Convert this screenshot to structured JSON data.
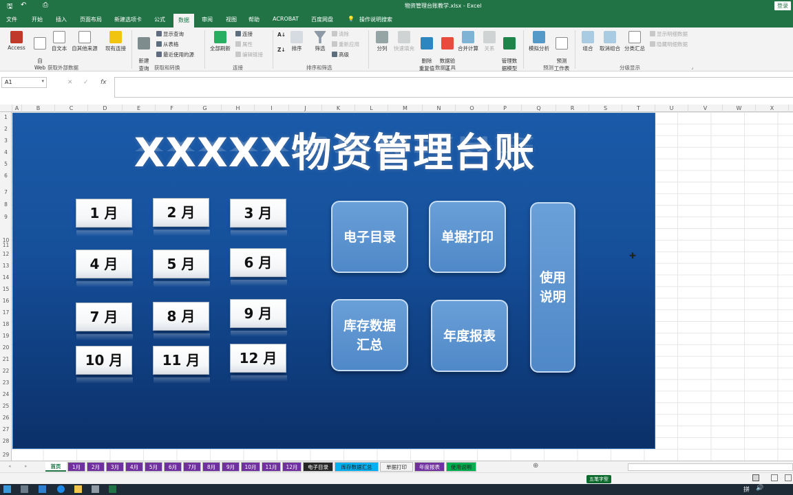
{
  "window": {
    "title": "物资管理台账教学.xlsx  -  Excel",
    "login_label": "登录"
  },
  "ribbon_tabs": [
    "文件",
    "开始",
    "插入",
    "页面布局",
    "新建选项卡",
    "公式",
    "数据",
    "审阅",
    "视图",
    "帮助",
    "ACROBAT",
    "百度网盘",
    "操作说明搜索"
  ],
  "ribbon_active_tab": "数据",
  "ribbon": {
    "get_external": {
      "access": "Access",
      "web": "自\nWeb",
      "text": "自文本",
      "other": "自其他来源",
      "existing": "现有连接",
      "group": "获取外部数据"
    },
    "transform": {
      "new_query": "新建\n查询",
      "show_queries": "显示查询",
      "from_table": "从表格",
      "recent_sources": "最近使用的源",
      "group": "获取和转换"
    },
    "connections": {
      "refresh_all": "全部刷新",
      "connections": "连接",
      "properties": "属性",
      "edit_links": "编辑链接",
      "group": "连接"
    },
    "sort_filter": {
      "sort": "排序",
      "filter": "筛选",
      "clear": "清除",
      "reapply": "重新应用",
      "advanced": "高级",
      "group": "排序和筛选"
    },
    "data_tools": {
      "split": "分列",
      "flash_fill": "快速填充",
      "remove_dup": "删除\n重复值",
      "validation": "数据验\n证",
      "consolidate": "合并计算",
      "relationships": "关系",
      "data_model": "管理数\n据模型",
      "group": "数据工具"
    },
    "forecast": {
      "what_if": "模拟分析",
      "forecast_sheet": "预测\n工作表",
      "group": "预测"
    },
    "outline": {
      "group_btn": "组合",
      "ungroup": "取消组合",
      "subtotal": "分类汇总",
      "show_detail": "显示明细数据",
      "hide_detail": "隐藏明细数据",
      "group": "分级显示"
    }
  },
  "formula_bar": {
    "name_box": "A1",
    "fx": "fx",
    "value": ""
  },
  "columns": [
    "A",
    "B",
    "C",
    "D",
    "E",
    "F",
    "G",
    "H",
    "I",
    "J",
    "K",
    "L",
    "M",
    "N",
    "O",
    "P",
    "Q",
    "R",
    "S",
    "T",
    "U",
    "V",
    "W",
    "X"
  ],
  "rows": [
    "1",
    "2",
    "3",
    "4",
    "5",
    "6",
    "7",
    "8",
    "9",
    "10",
    "11",
    "12",
    "13",
    "14",
    "15",
    "16",
    "17",
    "18",
    "19",
    "20",
    "21",
    "22",
    "23",
    "24",
    "25",
    "26",
    "27",
    "28",
    "29"
  ],
  "dashboard": {
    "title": "XXXXX物资管理台账",
    "months": [
      "1 月",
      "2 月",
      "3 月",
      "4 月",
      "5 月",
      "6 月",
      "7 月",
      "8 月",
      "9 月",
      "10 月",
      "11 月",
      "12 月"
    ],
    "nav": {
      "catalog": "电子目录",
      "print": "单据打印",
      "summary": "库存数据\n汇总",
      "annual": "年度报表",
      "manual": "使用\n说明"
    }
  },
  "sheet_tabs": [
    {
      "label": "首页",
      "color": "#ffffff",
      "text_color": "#217346",
      "active": true
    },
    {
      "label": "1月",
      "color": "#7030a0",
      "text_color": "#ffffff"
    },
    {
      "label": "2月",
      "color": "#7030a0",
      "text_color": "#ffffff"
    },
    {
      "label": "3月",
      "color": "#7030a0",
      "text_color": "#ffffff"
    },
    {
      "label": "4月",
      "color": "#7030a0",
      "text_color": "#ffffff"
    },
    {
      "label": "5月",
      "color": "#7030a0",
      "text_color": "#ffffff"
    },
    {
      "label": "6月",
      "color": "#7030a0",
      "text_color": "#ffffff"
    },
    {
      "label": "7月",
      "color": "#7030a0",
      "text_color": "#ffffff"
    },
    {
      "label": "8月",
      "color": "#7030a0",
      "text_color": "#ffffff"
    },
    {
      "label": "9月",
      "color": "#7030a0",
      "text_color": "#ffffff"
    },
    {
      "label": "10月",
      "color": "#7030a0",
      "text_color": "#ffffff"
    },
    {
      "label": "11月",
      "color": "#7030a0",
      "text_color": "#ffffff"
    },
    {
      "label": "12月",
      "color": "#7030a0",
      "text_color": "#ffffff"
    },
    {
      "label": "电子目录",
      "color": "#262626",
      "text_color": "#ffffff"
    },
    {
      "label": "库存数据汇总",
      "color": "#00b0f0",
      "text_color": "#1f1f1f"
    },
    {
      "label": "单据打印",
      "color": "#f3f3f3",
      "text_color": "#333333"
    },
    {
      "label": "年度报表",
      "color": "#7030a0",
      "text_color": "#ffffff"
    },
    {
      "label": "使用说明",
      "color": "#00b050",
      "text_color": "#1f1f1f"
    }
  ],
  "status": {
    "ime": "五笔字型",
    "taskbar_lang": "拼"
  },
  "colors": {
    "excel_green": "#217346",
    "dashboard_blue": "#16509b",
    "button_blue": "#5b93d0"
  }
}
